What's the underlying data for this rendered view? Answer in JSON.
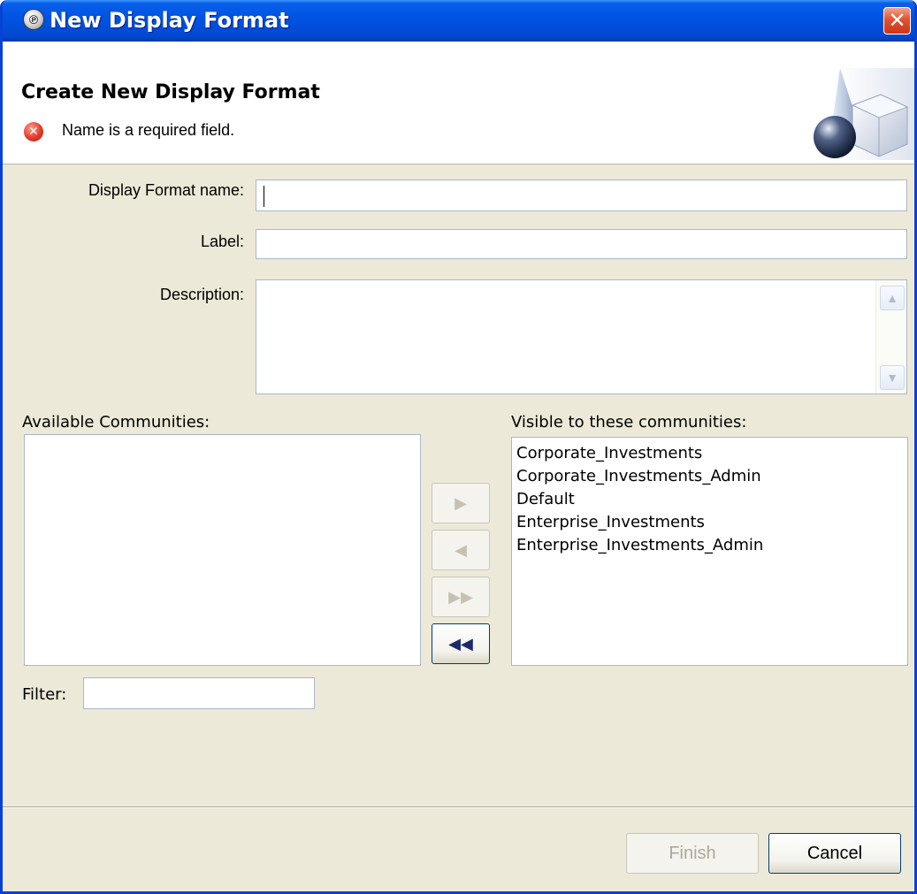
{
  "window": {
    "title": "New Display Format",
    "close_glyph": "✕"
  },
  "banner": {
    "title": "Create New Display Format",
    "error_message": "Name is a required field.",
    "error_glyph": "✕"
  },
  "form": {
    "display_format_name": {
      "label": "Display Format name:",
      "value": ""
    },
    "label": {
      "label": "Label:",
      "value": ""
    },
    "description": {
      "label": "Description:",
      "value": ""
    }
  },
  "communities": {
    "available_label": "Available Communities:",
    "available_items": [],
    "visible_label": "Visible to these communities:",
    "visible_items": [
      "Corporate_Investments",
      "Corporate_Investments_Admin",
      "Default",
      "Enterprise_Investments",
      "Enterprise_Investments_Admin"
    ],
    "move_buttons": {
      "add": "▶",
      "remove": "◀",
      "add_all": "▶▶",
      "remove_all": "◀◀"
    }
  },
  "filter": {
    "label": "Filter:",
    "value": ""
  },
  "buttons": {
    "finish": "Finish",
    "cancel": "Cancel"
  },
  "icons": {
    "title_icon": "app-icon",
    "error_icon": "error-icon",
    "banner_graphic": "shapes-graphic-icon"
  },
  "colors": {
    "titlebar": "#0054e3",
    "dialog_bg": "#ece9d8",
    "error": "#e23a2a"
  }
}
